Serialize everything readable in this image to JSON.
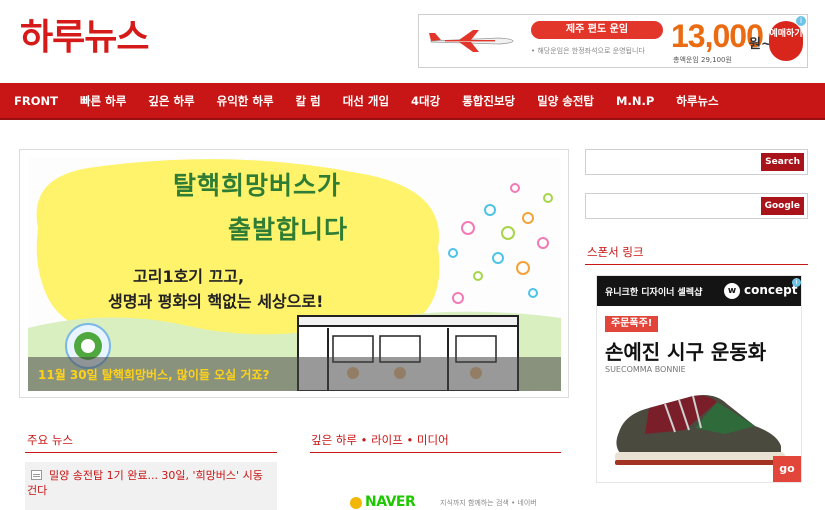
{
  "site": {
    "logo": "하루뉴스"
  },
  "top_ad": {
    "route": "제주 편도 운임",
    "fine_print": "• 해당운임은 한정좌석으로 운영됩니다",
    "price": "13,000",
    "price_unit": "원~",
    "total": "총액운임 29,100원",
    "cta": "예매하기"
  },
  "nav": {
    "items": [
      "FRONT",
      "빠른 하루",
      "깊은 하루",
      "유익한 하루",
      "칼 럼",
      "대선 개입",
      "4대강",
      "통합진보당",
      "밀양 송전탑",
      "M.N.P",
      "하루뉴스"
    ]
  },
  "feature": {
    "title_line1": "탈핵희망버스가",
    "title_line2": "출발합니다",
    "sub_line1": "고리1호기 끄고,",
    "sub_line2": "생명과 평화의 핵없는 세상으로!",
    "caption": "11월 30일 탈핵희망버스, 많이들 오실 거죠?"
  },
  "sidebar": {
    "search_button": "Search",
    "google_button": "Google",
    "sponsor_title": "스폰서 링크"
  },
  "sponsor_ad": {
    "bar_text": "유니크한 디자이너 셀렉샵",
    "brand_mark": "w",
    "brand": "concept",
    "tag": "주문폭주!",
    "headline": "손예진 시구 운동화",
    "sub": "SUECOMMA BONNIE",
    "go": "go"
  },
  "sections": {
    "main_news_title": "주요 뉴스",
    "deep_title": "깊은 하루 • 라이프 • 미디어"
  },
  "news": {
    "item1": "밀양 송전탑 1기 완료... 30일, '희망버스' 시동 건다"
  },
  "naver": {
    "logo": "NAVER",
    "tagline": "지식까지 함께하는 검색 • 네이버"
  },
  "colors": {
    "brand_red": "#c81515",
    "caption_yellow": "#ffd21a",
    "price_orange": "#ea6b12",
    "title_green": "#2f7d34"
  }
}
